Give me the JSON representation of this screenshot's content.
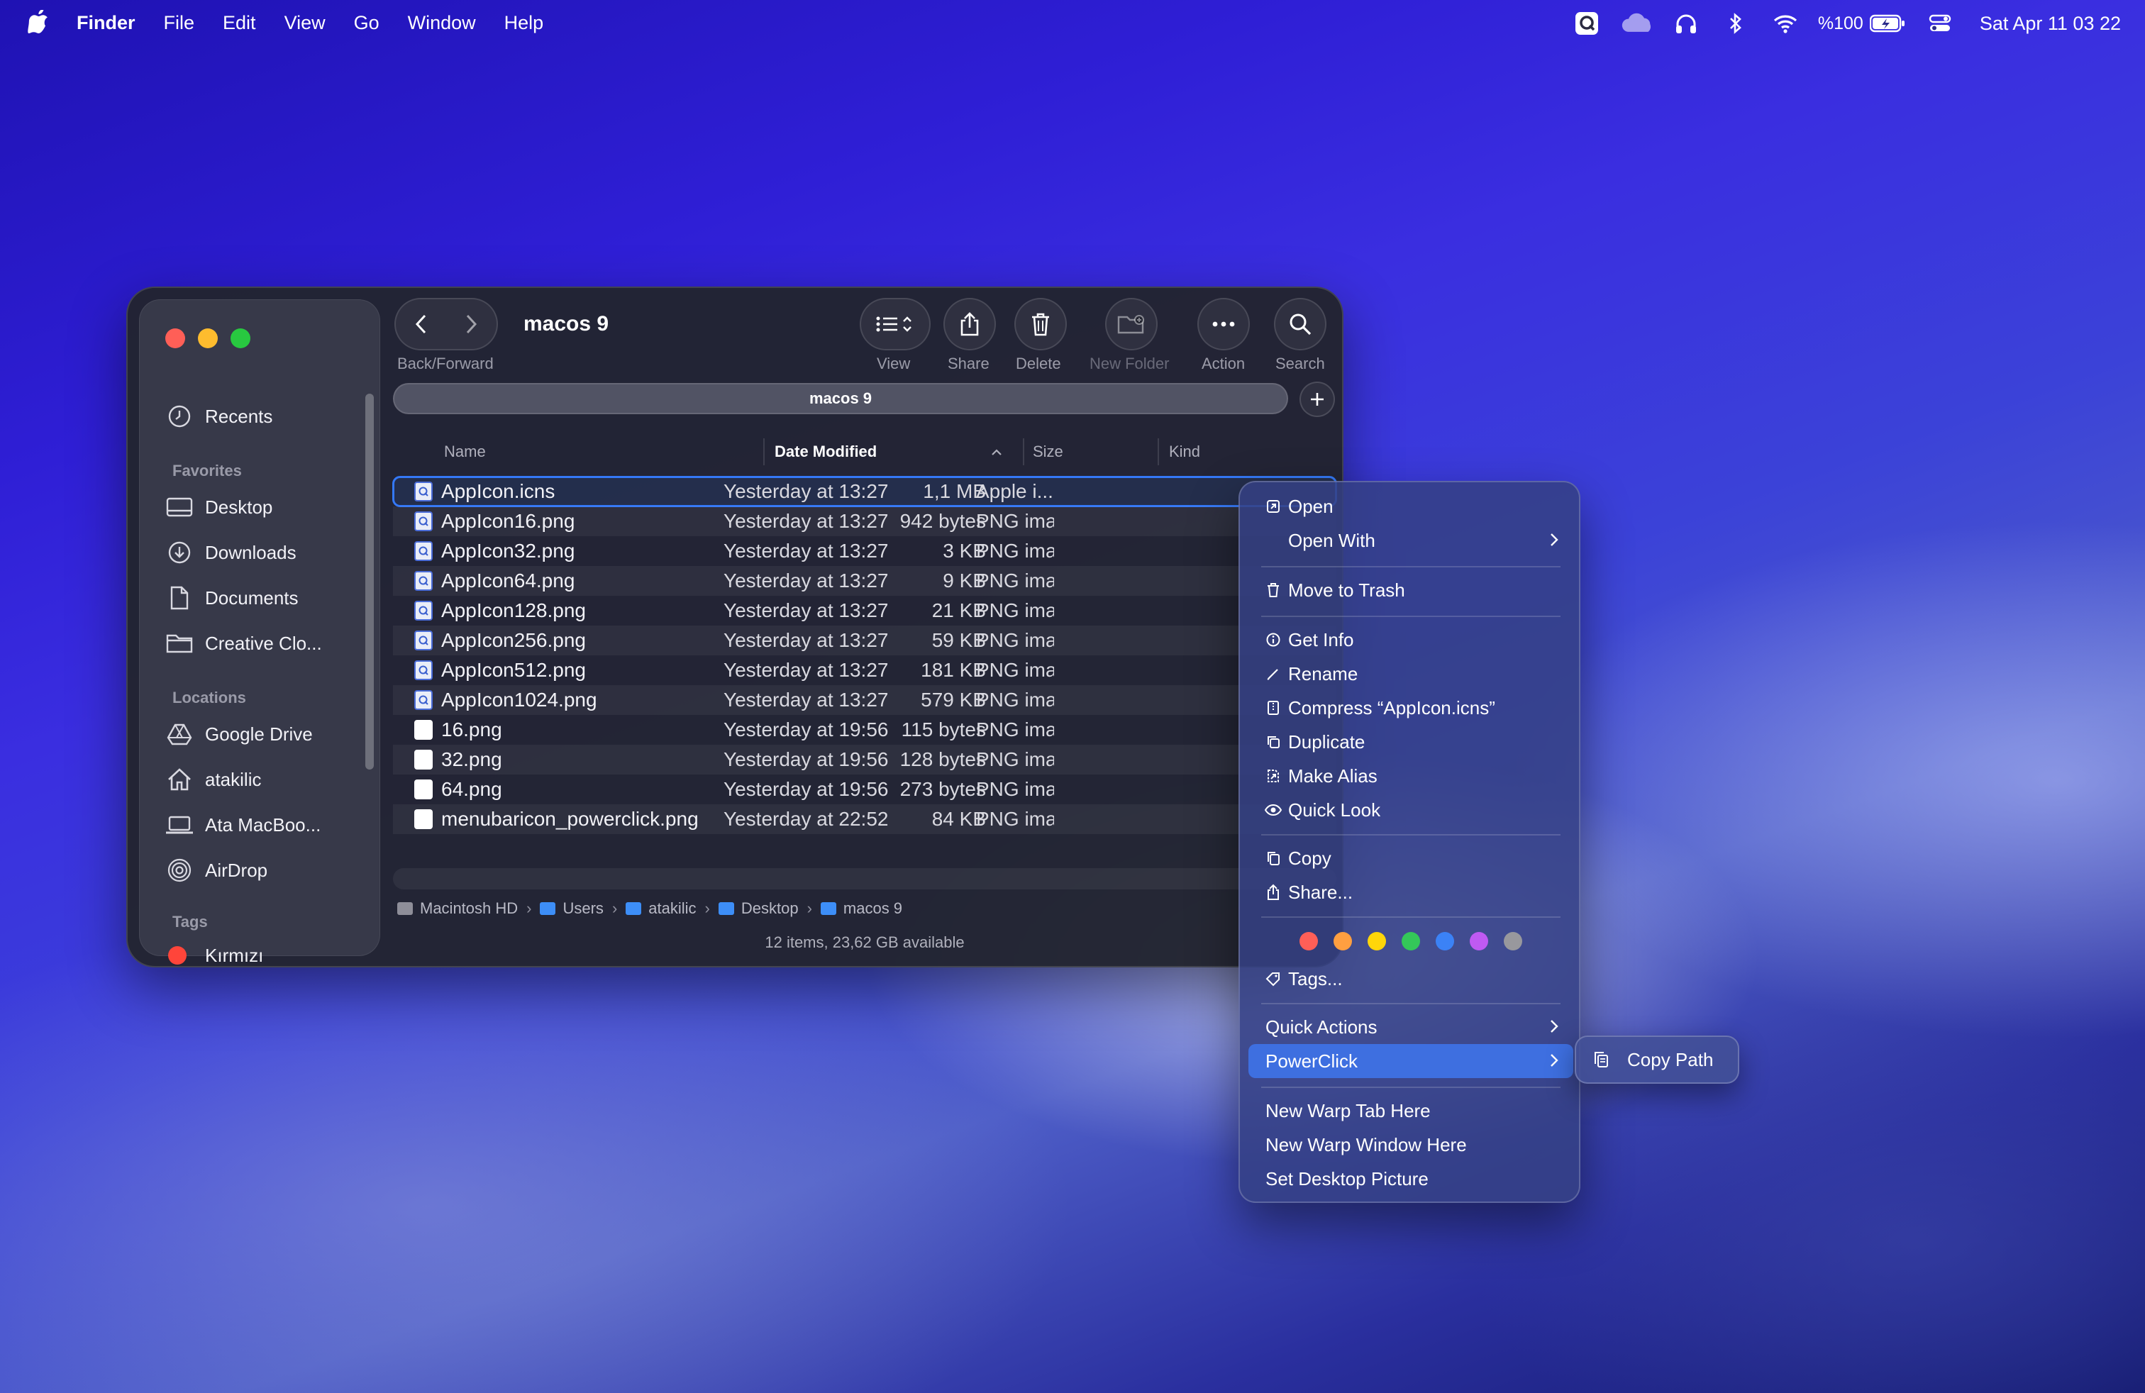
{
  "menubar": {
    "app_name": "Finder",
    "menus": [
      "File",
      "Edit",
      "View",
      "Go",
      "Window",
      "Help"
    ],
    "battery_text": "%100",
    "clock": "Sat Apr 11  03 22",
    "icons": [
      "q-app-icon",
      "cloud-icon",
      "headphones-icon",
      "bluetooth-icon",
      "wifi-icon",
      "battery-icon",
      "control-center-icon"
    ]
  },
  "window": {
    "title": "macos 9",
    "nav_label": "Back/Forward",
    "toolbar": {
      "view": "View",
      "share": "Share",
      "delete": "Delete",
      "new_folder": "New Folder",
      "action": "Action",
      "search": "Search"
    },
    "tab_label": "macos 9",
    "sidebar": {
      "recents": "Recents",
      "favorites_header": "Favorites",
      "favorites": [
        "Desktop",
        "Downloads",
        "Documents",
        "Creative Clo..."
      ],
      "locations_header": "Locations",
      "locations": [
        "Google Drive",
        "atakilic",
        "Ata MacBoo...",
        "AirDrop"
      ],
      "tags_header": "Tags",
      "tags": [
        "Kırmızı"
      ]
    },
    "columns": {
      "name": "Name",
      "date": "Date Modified",
      "size": "Size",
      "kind": "Kind"
    },
    "files": [
      {
        "name": "AppIcon.icns",
        "date": "Yesterday at 13:27",
        "size": "1,1 MB",
        "kind": "Apple i..."
      },
      {
        "name": "AppIcon16.png",
        "date": "Yesterday at 13:27",
        "size": "942 bytes",
        "kind": "PNG image"
      },
      {
        "name": "AppIcon32.png",
        "date": "Yesterday at 13:27",
        "size": "3 KB",
        "kind": "PNG image"
      },
      {
        "name": "AppIcon64.png",
        "date": "Yesterday at 13:27",
        "size": "9 KB",
        "kind": "PNG image"
      },
      {
        "name": "AppIcon128.png",
        "date": "Yesterday at 13:27",
        "size": "21 KB",
        "kind": "PNG image"
      },
      {
        "name": "AppIcon256.png",
        "date": "Yesterday at 13:27",
        "size": "59 KB",
        "kind": "PNG image"
      },
      {
        "name": "AppIcon512.png",
        "date": "Yesterday at 13:27",
        "size": "181 KB",
        "kind": "PNG image"
      },
      {
        "name": "AppIcon1024.png",
        "date": "Yesterday at 13:27",
        "size": "579 KB",
        "kind": "PNG image"
      },
      {
        "name": "16.png",
        "date": "Yesterday at 19:56",
        "size": "115 bytes",
        "kind": "PNG image"
      },
      {
        "name": "32.png",
        "date": "Yesterday at 19:56",
        "size": "128 bytes",
        "kind": "PNG image"
      },
      {
        "name": "64.png",
        "date": "Yesterday at 19:56",
        "size": "273 bytes",
        "kind": "PNG image"
      },
      {
        "name": "menubaricon_powerclick.png",
        "date": "Yesterday at 22:52",
        "size": "84 KB",
        "kind": "PNG image"
      }
    ],
    "breadcrumb": [
      "Macintosh HD",
      "Users",
      "atakilic",
      "Desktop",
      "macos 9"
    ],
    "status": "12 items, 23,62 GB available"
  },
  "context_menu": {
    "open": "Open",
    "open_with": "Open With",
    "move_to_trash": "Move to Trash",
    "get_info": "Get Info",
    "rename": "Rename",
    "compress": "Compress “AppIcon.icns”",
    "duplicate": "Duplicate",
    "make_alias": "Make Alias",
    "quick_look": "Quick Look",
    "copy": "Copy",
    "share": "Share...",
    "tag_colors": [
      "#ff5f57",
      "#ff9f40",
      "#ffd60a",
      "#34c759",
      "#3b82f6",
      "#bf5af2",
      "#98989d"
    ],
    "tags": "Tags...",
    "quick_actions": "Quick Actions",
    "powerclick": "PowerClick",
    "new_warp_tab": "New Warp Tab Here",
    "new_warp_window": "New Warp Window Here",
    "set_desktop_picture": "Set Desktop Picture"
  },
  "submenu": {
    "copy_path": "Copy Path"
  }
}
